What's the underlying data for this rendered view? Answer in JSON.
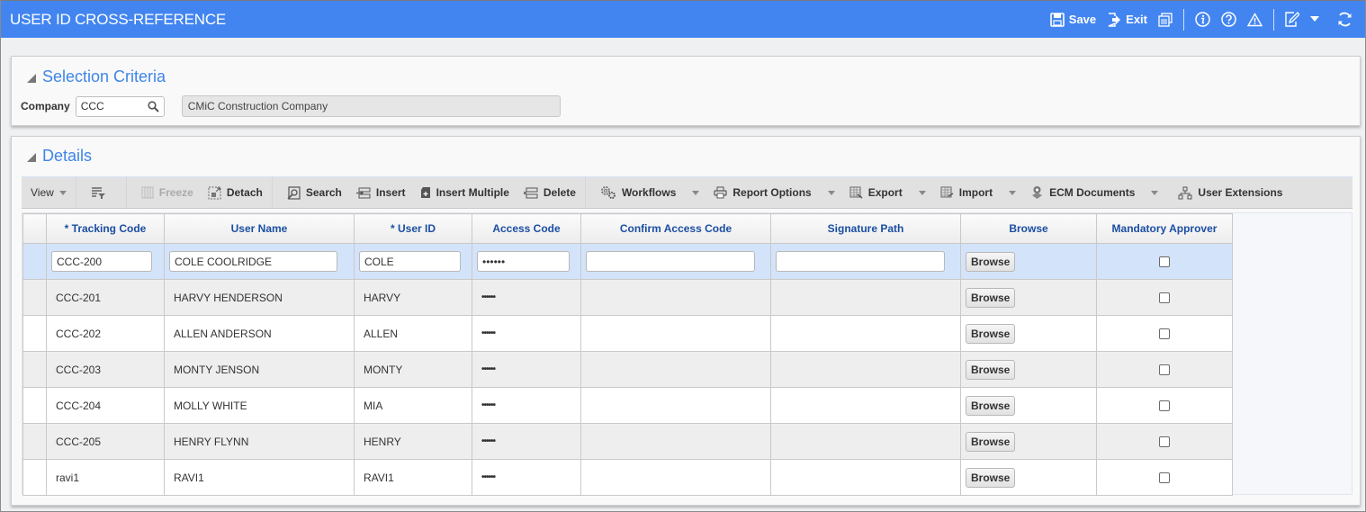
{
  "app": {
    "title": "USER ID CROSS-REFERENCE",
    "brand_color": "#4285f0",
    "header_text_color": "#3f85e8"
  },
  "top_actions": {
    "save_label": "Save",
    "exit_label": "Exit",
    "icons": [
      "save-icon",
      "exit-icon",
      "print-icon",
      "info-icon",
      "help-icon",
      "warning-icon",
      "edit-icon",
      "dropdown-icon",
      "refresh-icon"
    ]
  },
  "selection": {
    "title": "Selection Criteria",
    "company_label": "Company",
    "company_value": "CCC",
    "company_name": "CMiC Construction Company"
  },
  "details": {
    "title": "Details",
    "toolbar": {
      "view": "View",
      "freeze": "Freeze",
      "detach": "Detach",
      "search": "Search",
      "insert": "Insert",
      "insert_multiple": "Insert Multiple",
      "delete": "Delete",
      "workflows": "Workflows",
      "report_options": "Report Options",
      "export": "Export",
      "import": "Import",
      "ecm_documents": "ECM Documents",
      "user_extensions": "User Extensions"
    },
    "columns": [
      "* Tracking Code",
      "User Name",
      "* User ID",
      "Access Code",
      "Confirm Access Code",
      "Signature Path",
      "Browse",
      "Mandatory Approver"
    ],
    "browse_label": "Browse",
    "active_row": {
      "tracking_code": "CCC-200",
      "user_name": "COLE COOLRIDGE",
      "user_id": "COLE",
      "access_code": "••••••",
      "confirm_access_code": "",
      "signature_path": "",
      "mandatory_approver": false
    },
    "rows": [
      {
        "tracking_code": "CCC-201",
        "user_name": "HARVY HENDERSON",
        "user_id": "HARVY",
        "access_code": "••••••",
        "confirm_access_code": "",
        "signature_path": "",
        "mandatory_approver": false
      },
      {
        "tracking_code": "CCC-202",
        "user_name": "ALLEN ANDERSON",
        "user_id": "ALLEN",
        "access_code": "••••••",
        "confirm_access_code": "",
        "signature_path": "",
        "mandatory_approver": false
      },
      {
        "tracking_code": "CCC-203",
        "user_name": "MONTY JENSON",
        "user_id": "MONTY",
        "access_code": "••••••",
        "confirm_access_code": "",
        "signature_path": "",
        "mandatory_approver": false
      },
      {
        "tracking_code": "CCC-204",
        "user_name": "MOLLY WHITE",
        "user_id": "MIA",
        "access_code": "••••••",
        "confirm_access_code": "",
        "signature_path": "",
        "mandatory_approver": false
      },
      {
        "tracking_code": "CCC-205",
        "user_name": "HENRY FLYNN",
        "user_id": "HENRY",
        "access_code": "••••••",
        "confirm_access_code": "",
        "signature_path": "",
        "mandatory_approver": false
      },
      {
        "tracking_code": "ravi1",
        "user_name": "RAVI1",
        "user_id": "RAVI1",
        "access_code": "••••••",
        "confirm_access_code": "",
        "signature_path": "",
        "mandatory_approver": false
      }
    ]
  }
}
